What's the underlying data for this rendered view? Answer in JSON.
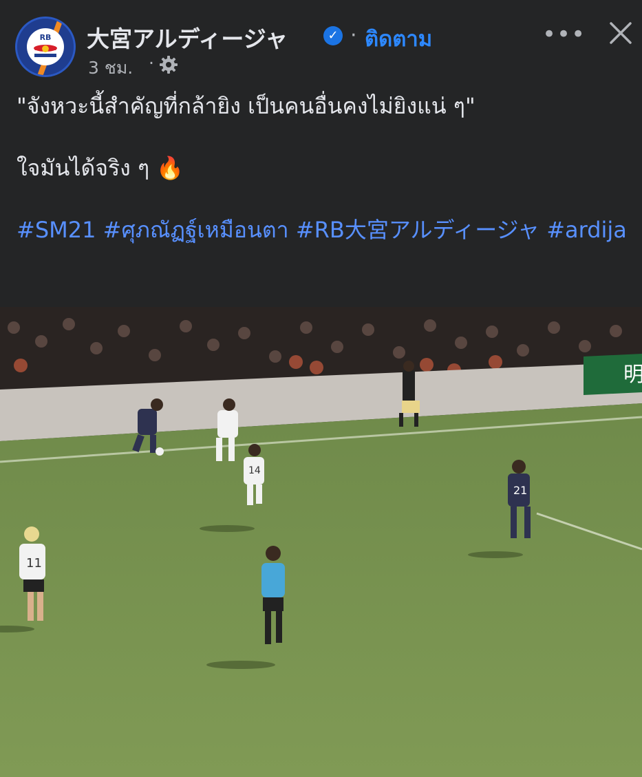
{
  "page": {
    "name": "大宮アルディージャ",
    "follow_label": "ติดตาม",
    "time": "3 ชม.",
    "separator": "·",
    "more_label": "•••"
  },
  "icons": {
    "verified": "verified-badge-icon",
    "privacy": "gear-icon",
    "more": "more-options-icon",
    "close": "close-icon"
  },
  "post": {
    "line1": "\"จังหวะนี้สำคัญที่กล้ายิง เป็นคนอื่นคงไม่ยิงแน่ ๆ\"",
    "line2": "ใจมันได้จริง ๆ 🔥",
    "hashtags": [
      "#SM21",
      "#ศุภณัฏฐ์เหมือนตา",
      "#RB大宮アルディージャ",
      "#ardija"
    ]
  },
  "video": {
    "banner_text": "明",
    "player_numbers": [
      "21",
      "11",
      "14"
    ]
  },
  "colors": {
    "background": "#242526",
    "text": "#e4e6eb",
    "muted": "#b0b3b8",
    "link": "#5890ff",
    "follow": "#2d88ff",
    "pitch": "#6f8a4a"
  }
}
